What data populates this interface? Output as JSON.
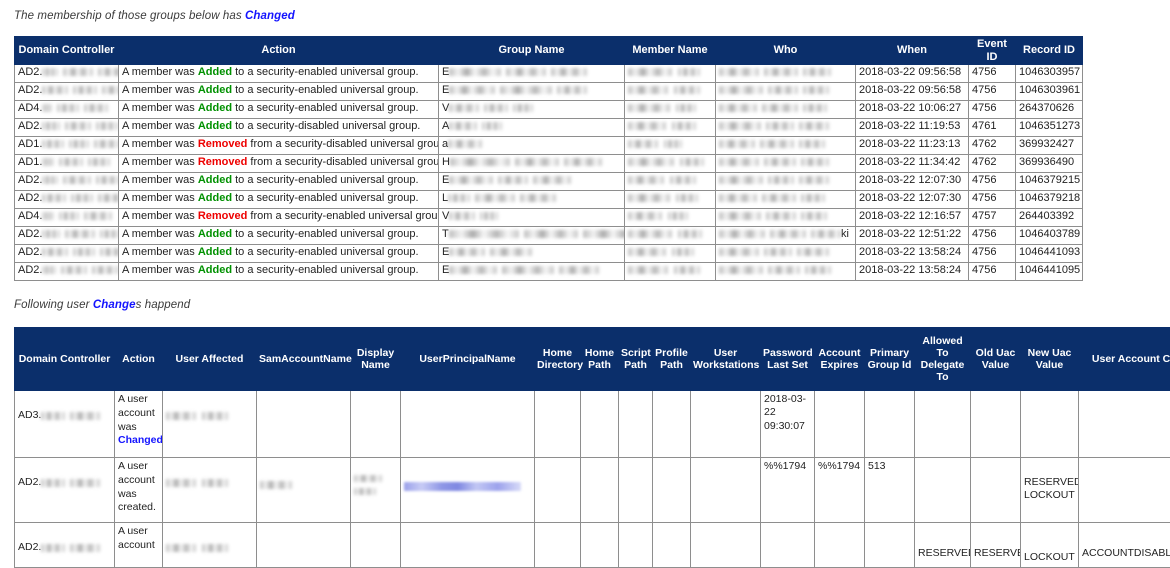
{
  "report": {
    "section1": {
      "caption_pre": "The membership of those groups below has ",
      "caption_hl": "Changed",
      "caption_post": "",
      "columns": [
        "Domain Controller",
        "Action",
        "Group Name",
        "Member Name",
        "Who",
        "When",
        "Event ID",
        "Record ID"
      ],
      "rows": [
        {
          "dc": "AD2.",
          "action_pre": "A member was ",
          "verb": "Added",
          "verb_kind": "added",
          "action_post": " to a security-enabled universal group.",
          "group": "E",
          "member": "",
          "who": "",
          "when": "2018-03-22 09:56:58",
          "event_id": "4756",
          "record_id": "1046303957"
        },
        {
          "dc": "AD2.",
          "action_pre": "A member was ",
          "verb": "Added",
          "verb_kind": "added",
          "action_post": " to a security-enabled universal group.",
          "group": "E",
          "member": "",
          "who": "",
          "when": "2018-03-22 09:56:58",
          "event_id": "4756",
          "record_id": "1046303961"
        },
        {
          "dc": "AD4.",
          "action_pre": "A member was ",
          "verb": "Added",
          "verb_kind": "added",
          "action_post": " to a security-enabled universal group.",
          "group": "V",
          "member": "",
          "who": "",
          "when": "2018-03-22 10:06:27",
          "event_id": "4756",
          "record_id": "264370626"
        },
        {
          "dc": "AD2.",
          "action_pre": "A member was ",
          "verb": "Added",
          "verb_kind": "added",
          "action_post": " to a security-disabled universal group.",
          "group": "A",
          "member": "",
          "who": "",
          "when": "2018-03-22 11:19:53",
          "event_id": "4761",
          "record_id": "1046351273"
        },
        {
          "dc": "AD1.",
          "action_pre": "A member was ",
          "verb": "Removed",
          "verb_kind": "removed",
          "action_post": " from a security-disabled universal group.",
          "group": "a",
          "member": "",
          "who": "",
          "when": "2018-03-22 11:23:13",
          "event_id": "4762",
          "record_id": "369932427"
        },
        {
          "dc": "AD1.",
          "action_pre": "A member was ",
          "verb": "Removed",
          "verb_kind": "removed",
          "action_post": " from a security-disabled universal group.",
          "group": "H",
          "member": "",
          "who": "",
          "when": "2018-03-22 11:34:42",
          "event_id": "4762",
          "record_id": "369936490"
        },
        {
          "dc": "AD2.",
          "action_pre": "A member was ",
          "verb": "Added",
          "verb_kind": "added",
          "action_post": " to a security-enabled universal group.",
          "group": "E",
          "member": "",
          "who": "",
          "when": "2018-03-22 12:07:30",
          "event_id": "4756",
          "record_id": "1046379215"
        },
        {
          "dc": "AD2.",
          "action_pre": "A member was ",
          "verb": "Added",
          "verb_kind": "added",
          "action_post": " to a security-enabled universal group.",
          "group": "L",
          "member": "",
          "who": "",
          "when": "2018-03-22 12:07:30",
          "event_id": "4756",
          "record_id": "1046379218"
        },
        {
          "dc": "AD4.",
          "action_pre": "A member was ",
          "verb": "Removed",
          "verb_kind": "removed",
          "action_post": " from a security-enabled universal group.",
          "group": "V",
          "member": "",
          "who": "",
          "when": "2018-03-22 12:16:57",
          "event_id": "4757",
          "record_id": "264403392"
        },
        {
          "dc": "AD2.",
          "action_pre": "A member was ",
          "verb": "Added",
          "verb_kind": "added",
          "action_post": " to a security-enabled universal group.",
          "group": "T",
          "member": "",
          "who": "ki",
          "when": "2018-03-22 12:51:22",
          "event_id": "4756",
          "record_id": "1046403789"
        },
        {
          "dc": "AD2.",
          "action_pre": "A member was ",
          "verb": "Added",
          "verb_kind": "added",
          "action_post": " to a security-enabled universal group.",
          "group": "E",
          "member": "",
          "who": "",
          "when": "2018-03-22 13:58:24",
          "event_id": "4756",
          "record_id": "1046441093"
        },
        {
          "dc": "AD2.",
          "action_pre": "A member was ",
          "verb": "Added",
          "verb_kind": "added",
          "action_post": " to a security-enabled universal group.",
          "group": "E",
          "member": "",
          "who": "",
          "when": "2018-03-22 13:58:24",
          "event_id": "4756",
          "record_id": "1046441095"
        }
      ]
    },
    "section2": {
      "caption_pre": "Following user ",
      "caption_hl": "Change",
      "caption_post": "s happend",
      "columns": [
        "Domain Controller",
        "Action",
        "User Affected",
        "SamAccountName",
        "Display Name",
        "UserPrincipalName",
        "Home Directory",
        "Home Path",
        "Script Path",
        "Profile Path",
        "User Workstations",
        "Password Last Set",
        "Account Expires",
        "Primary Group Id",
        "Allowed To Delegate To",
        "Old Uac Value",
        "New Uac Value",
        "User Account Con"
      ],
      "rows": [
        {
          "dc": "AD3.",
          "action_pre": "A user account was ",
          "verb": "Changed",
          "verb_kind": "changed",
          "action_post": ".",
          "user_affected": "",
          "sam": "",
          "display": "",
          "upn": "",
          "home_dir": "",
          "home_path": "",
          "script_path": "",
          "profile_path": "",
          "workstations": "",
          "pwd_last_set": "2018-03-22 09:30:07",
          "account_expires": "",
          "primary_group_id": "",
          "delegate": "",
          "old_uac": "",
          "new_uac": "",
          "uac_control": ""
        },
        {
          "dc": "AD2.",
          "action_pre": "A user account was created.",
          "verb": "",
          "verb_kind": "plain",
          "action_post": "",
          "user_affected": "",
          "sam": "",
          "display": "",
          "upn": "",
          "home_dir": "",
          "home_path": "",
          "script_path": "",
          "profile_path": "",
          "workstations": "",
          "pwd_last_set": "%%1794",
          "account_expires": "%%1794",
          "primary_group_id": "513",
          "delegate": "",
          "old_uac": "",
          "new_uac": "RESERVED, LOCKOUT",
          "uac_control": ""
        },
        {
          "dc": "AD2.",
          "action_pre": "A user account",
          "verb": "",
          "verb_kind": "plain",
          "action_post": "",
          "user_affected": "",
          "sam": "",
          "display": "",
          "upn": "",
          "home_dir": "",
          "home_path": "",
          "script_path": "",
          "profile_path": "",
          "workstations": "",
          "pwd_last_set": "",
          "account_expires": "",
          "primary_group_id": "",
          "delegate": "RESERVED,",
          "old_uac": "RESERVED,",
          "new_uac": "LOCKOUT",
          "uac_control": "ACCOUNTDISABLE,"
        }
      ]
    }
  }
}
